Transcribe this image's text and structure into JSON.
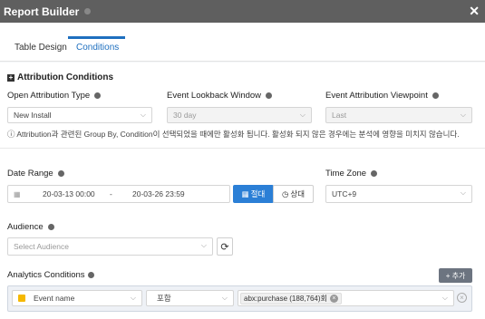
{
  "window": {
    "title": "Report Builder",
    "close_glyph": "✕"
  },
  "tabs": [
    {
      "label": "Table Design",
      "active": false
    },
    {
      "label": "Conditions",
      "active": true
    }
  ],
  "attribution": {
    "section_title": "Attribution Conditions",
    "open_type": {
      "label": "Open Attribution Type",
      "value": "New Install"
    },
    "lookback": {
      "label": "Event Lookback Window",
      "value": "30 day"
    },
    "viewpoint": {
      "label": "Event Attribution Viewpoint",
      "value": "Last"
    },
    "note": "ⓘ Attribution과 관련된 Group By, Condition이 선택되었을 때에만 활성화 됩니다. 활성화 되지 않은 경우에는 분석에 영향을 미치지 않습니다."
  },
  "date_range": {
    "label": "Date Range",
    "start": "20-03-13 00:00",
    "separator": "-",
    "end": "20-03-26 23:59",
    "absolute_label": "절대",
    "relative_label": "상대"
  },
  "time_zone": {
    "label": "Time Zone",
    "value": "UTC+9"
  },
  "audience": {
    "label": "Audience",
    "placeholder": "Select Audience",
    "refresh_glyph": "⟳"
  },
  "analytics": {
    "label": "Analytics Conditions",
    "add_label": "+ 추가",
    "condition": {
      "field": "Event name",
      "operator": "포함",
      "value_tag": "abx:purchase (188,764)회"
    }
  },
  "colors": {
    "accent": "#2b7fd6",
    "titlebar": "#5f5f5f",
    "event_icon": "#f5b800"
  },
  "icons": [
    "close-icon",
    "info-icon",
    "calendar-icon",
    "chevron-down-icon",
    "refresh-icon",
    "event-icon",
    "remove-icon"
  ]
}
